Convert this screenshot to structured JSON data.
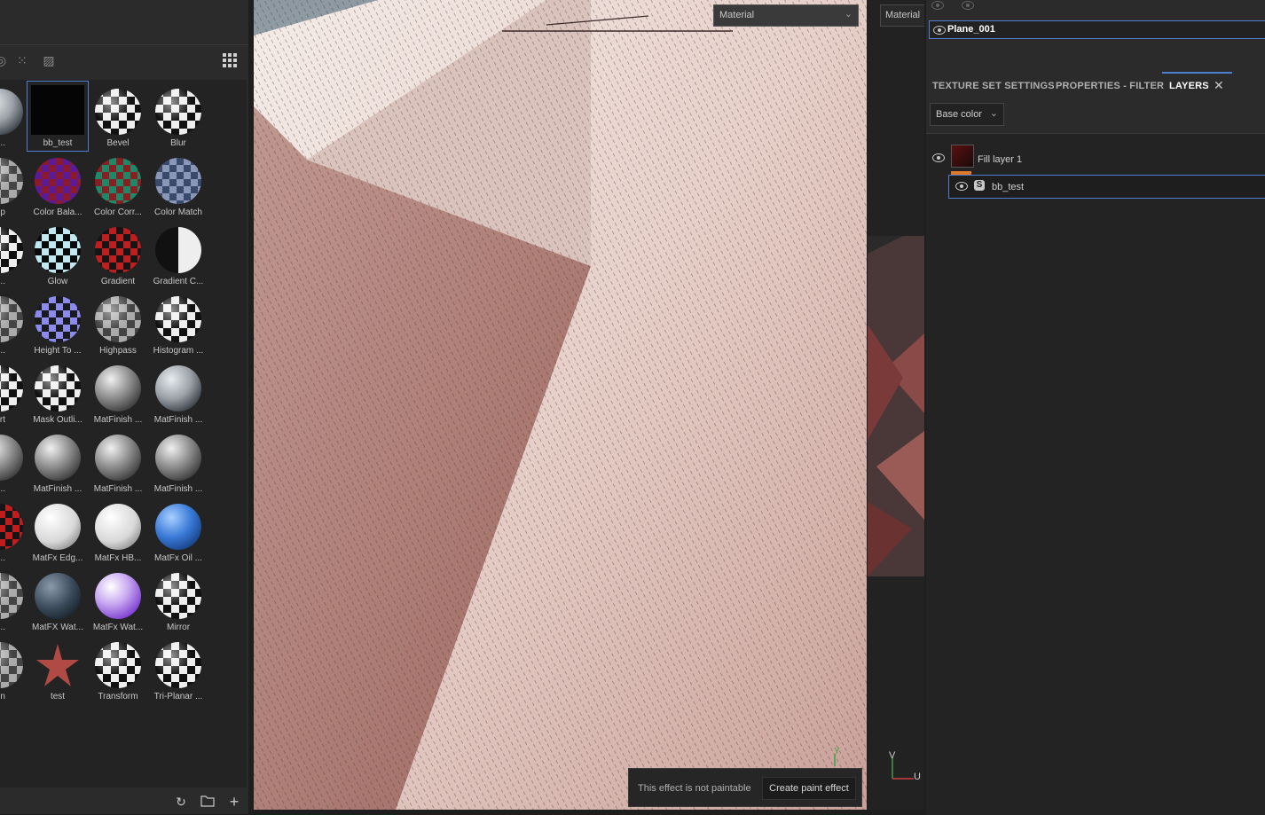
{
  "shelf": {
    "items": [
      {
        "label": "Lig...",
        "style": "metal-b",
        "cut": true
      },
      {
        "label": "bb_test",
        "style": "black-sq",
        "selected": true
      },
      {
        "label": "Bevel",
        "style": "ck-bw"
      },
      {
        "label": "Blur",
        "style": "ck-bw"
      },
      {
        "label": "mp",
        "style": "ck-grey",
        "cut": true
      },
      {
        "label": "Color Bala...",
        "style": "ck-rgbp"
      },
      {
        "label": "Color Corr...",
        "style": "ck-cc"
      },
      {
        "label": "Color Match",
        "style": "ck-cm"
      },
      {
        "label": "had...",
        "style": "ck-bw",
        "cut": true
      },
      {
        "label": "Glow",
        "style": "ck-glow"
      },
      {
        "label": "Gradient",
        "style": "ck-red"
      },
      {
        "label": "Gradient C...",
        "style": "grad-bw"
      },
      {
        "label": "Ble...",
        "style": "ck-grey",
        "cut": true
      },
      {
        "label": "Height To ...",
        "style": "ck-hgt"
      },
      {
        "label": "Highpass",
        "style": "ck-grey"
      },
      {
        "label": "Histogram ...",
        "style": "ck-bw"
      },
      {
        "label": "ert",
        "style": "ck-bw",
        "cut": true
      },
      {
        "label": "Mask Outli...",
        "style": "ck-bw"
      },
      {
        "label": "MatFinish ...",
        "style": "metal"
      },
      {
        "label": "MatFinish ...",
        "style": "metal-b"
      },
      {
        "label": "ish ...",
        "style": "metal",
        "cut": true
      },
      {
        "label": "MatFinish ...",
        "style": "metal"
      },
      {
        "label": "MatFinish ...",
        "style": "metal"
      },
      {
        "label": "MatFinish ...",
        "style": "metal"
      },
      {
        "label": "Det...",
        "style": "ck-red",
        "cut": true
      },
      {
        "label": "MatFx Edg...",
        "style": "white-b"
      },
      {
        "label": "MatFx HB...",
        "style": "white-b"
      },
      {
        "label": "MatFx Oil ...",
        "style": "blue-b"
      },
      {
        "label": "Shu...",
        "style": "ck-grey",
        "cut": true
      },
      {
        "label": "MatFX Wat...",
        "style": "dark-b"
      },
      {
        "label": "MatFx Wat...",
        "style": "purple-b"
      },
      {
        "label": "Mirror",
        "style": "ck-bw"
      },
      {
        "label": "pen",
        "style": "ck-grey",
        "cut": true
      },
      {
        "label": "test",
        "style": "star"
      },
      {
        "label": "Transform",
        "style": "ck-bw"
      },
      {
        "label": "Tri-Planar ...",
        "style": "ck-bw"
      }
    ]
  },
  "viewport": {
    "material_select": "Material",
    "toast_text": "This effect is not paintable",
    "toast_button": "Create paint effect",
    "axis_y": "Y"
  },
  "uv_view": {
    "select_label": "Material",
    "axis_v": "V",
    "axis_u": "U"
  },
  "right_panel": {
    "object_name": "Plane_001",
    "tabs": [
      "TEXTURE SET SETTINGS",
      "PROPERTIES - FILTER",
      "LAYERS"
    ],
    "active_tab": "LAYERS",
    "channel": "Base color",
    "layers": [
      {
        "name": "Fill layer 1",
        "effects": [
          {
            "name": "bb_test"
          }
        ]
      }
    ]
  },
  "colors": {
    "accent": "#4f7fd0",
    "layer_marker": "#e0782a",
    "panel_bg": "#2b2b2b"
  }
}
